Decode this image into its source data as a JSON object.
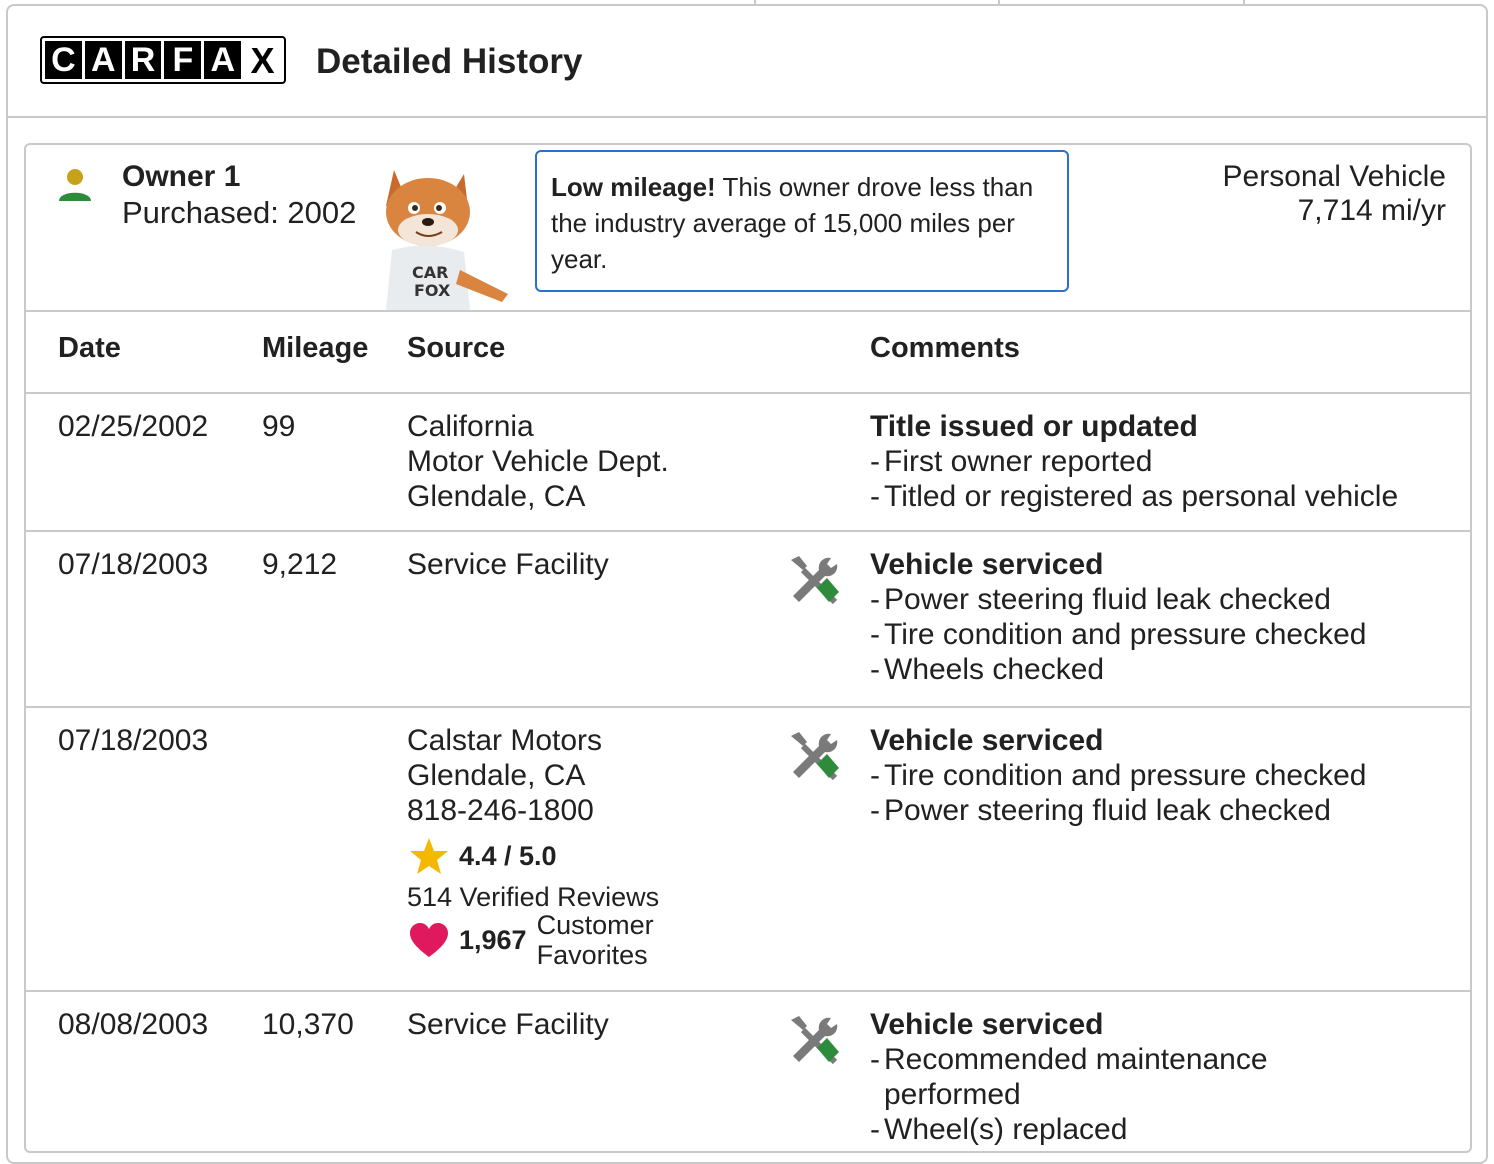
{
  "header": {
    "logo_letters": [
      "C",
      "A",
      "R",
      "F",
      "A",
      "X"
    ],
    "title": "Detailed History"
  },
  "owner": {
    "name": "Owner 1",
    "purchased": "Purchased: 2002",
    "vehicle_type": "Personal Vehicle",
    "miles_per_year": "7,714 mi/yr",
    "callout_bold": "Low mileage!",
    "callout_text": " This owner drove less than the industry average of 15,000 miles per year.",
    "fox_shirt": "CAR FOX"
  },
  "columns": {
    "date": "Date",
    "mileage": "Mileage",
    "source": "Source",
    "comments": "Comments"
  },
  "records": [
    {
      "date": "02/25/2002",
      "mileage": "99",
      "source": [
        "California",
        "Motor Vehicle Dept.",
        "Glendale, CA"
      ],
      "title": "Title issued or updated",
      "details": [
        "First owner reported",
        "Titled or registered as personal vehicle"
      ]
    },
    {
      "date": "07/18/2003",
      "mileage": "9,212",
      "source": [
        "Service Facility"
      ],
      "title": "Vehicle serviced",
      "details": [
        "Power steering fluid leak checked",
        "Tire condition and pressure checked",
        "Wheels checked"
      ]
    },
    {
      "date": "07/18/2003",
      "mileage": "",
      "source": [
        "Calstar Motors",
        "Glendale, CA",
        "818-246-1800"
      ],
      "rating": "4.4 / 5.0",
      "reviews": "514 Verified Reviews",
      "favorites_count": "1,967",
      "favorites_label": [
        "Customer",
        "Favorites"
      ],
      "title": "Vehicle serviced",
      "details": [
        "Tire condition and pressure checked",
        "Power steering fluid leak checked"
      ]
    },
    {
      "date": "08/08/2003",
      "mileage": "10,370",
      "source": [
        "Service Facility"
      ],
      "title": "Vehicle serviced",
      "details": [
        "Recommended maintenance performed",
        "Wheel(s) replaced"
      ]
    }
  ],
  "colors": {
    "border": "#c9c9c9",
    "callout_border": "#2b70c9",
    "owner_head": "#c8a11a",
    "owner_body": "#2e8b3b",
    "star": "#f5b800",
    "heart": "#e0195e",
    "wrench_grey": "#7a7a7a",
    "wrench_green": "#2e8b3b"
  }
}
